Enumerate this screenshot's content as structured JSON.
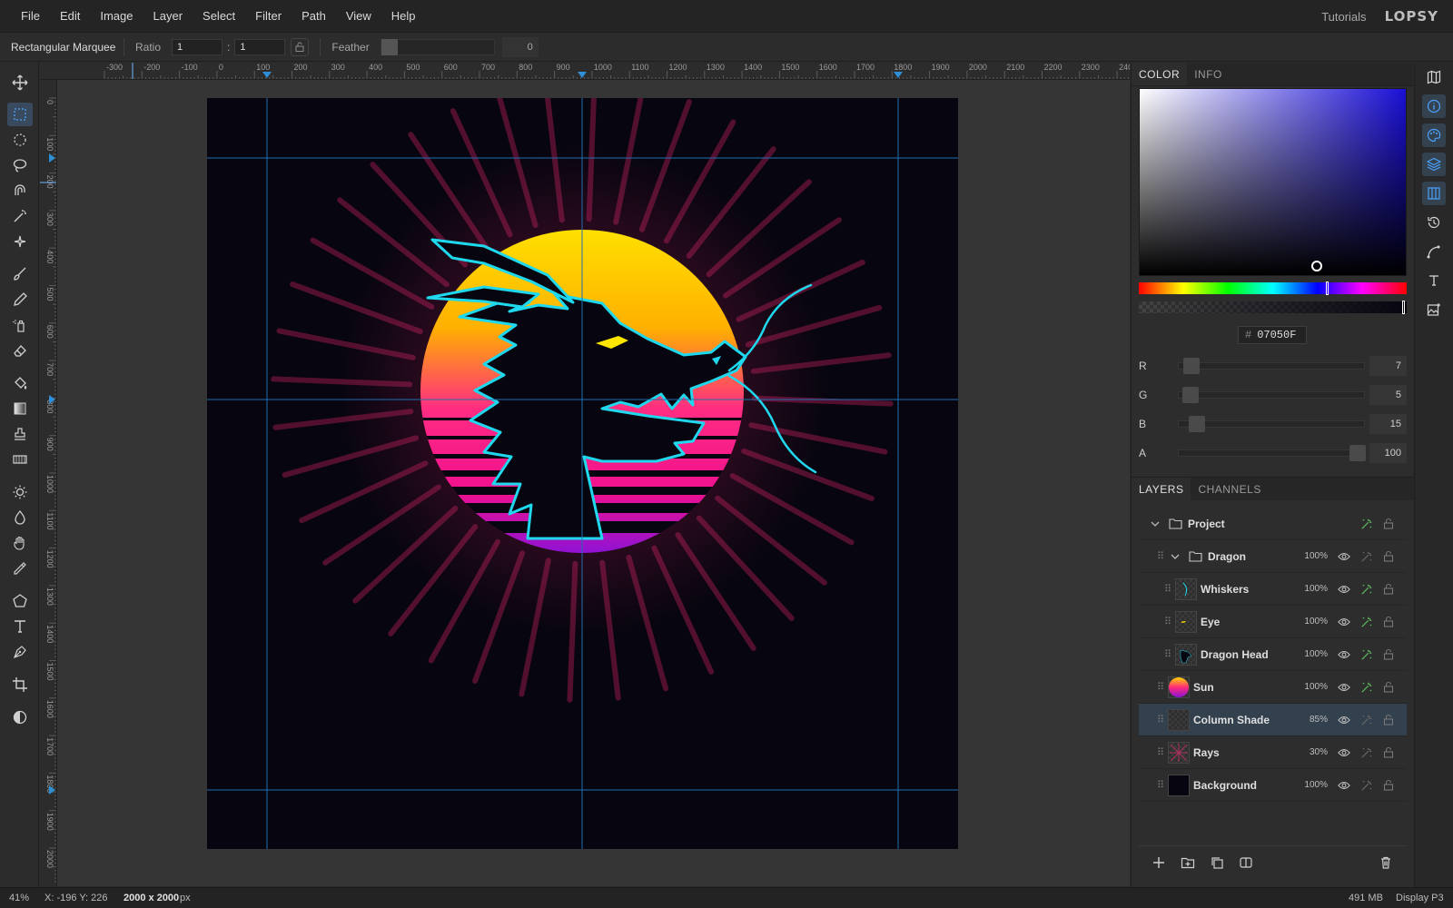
{
  "menu": {
    "items": [
      "File",
      "Edit",
      "Image",
      "Layer",
      "Select",
      "Filter",
      "Path",
      "View",
      "Help"
    ],
    "tutorials": "Tutorials",
    "logo": "LOPSY"
  },
  "options": {
    "tool_name": "Rectangular Marquee",
    "ratio_label": "Ratio",
    "ratio_w": "1",
    "ratio_colon": ":",
    "ratio_h": "1",
    "feather_label": "Feather",
    "feather_value": "0"
  },
  "rulers": {
    "top_labels": [
      "-300",
      "-200",
      "-100",
      "0",
      "100",
      "200",
      "300",
      "400",
      "500",
      "600",
      "700",
      "800",
      "900",
      "1000",
      "1100",
      "1200",
      "1300",
      "1400",
      "1500",
      "1600",
      "1700",
      "1800",
      "1900",
      "2000",
      "2100",
      "2200",
      "2300",
      "240"
    ],
    "left_labels": [
      "0",
      "100",
      "200",
      "300",
      "400",
      "500",
      "600",
      "700",
      "800",
      "900",
      "1000",
      "1100",
      "1200",
      "1300",
      "1400",
      "1500",
      "1600",
      "1700",
      "1800",
      "1900",
      "2000"
    ]
  },
  "color_panel": {
    "tabs": [
      "COLOR",
      "INFO"
    ],
    "hex_prefix": "#",
    "hex": "07050F",
    "hue_level": 0.7,
    "sat_level": 0.66,
    "brightness_level": 0.06,
    "channels": [
      {
        "label": "R",
        "value": "7",
        "level": 0.027
      },
      {
        "label": "G",
        "value": "5",
        "level": 0.02
      },
      {
        "label": "B",
        "value": "15",
        "level": 0.059
      },
      {
        "label": "A",
        "value": "100",
        "level": 1.0
      }
    ]
  },
  "layers_panel": {
    "tabs": [
      "LAYERS",
      "CHANNELS"
    ],
    "layers": [
      {
        "name": "Project",
        "opacity": "",
        "kind": "group",
        "depth": 0
      },
      {
        "name": "Dragon",
        "opacity": "100%",
        "kind": "group",
        "depth": 1
      },
      {
        "name": "Whiskers",
        "opacity": "100%",
        "kind": "layer",
        "depth": 2
      },
      {
        "name": "Eye",
        "opacity": "100%",
        "kind": "layer",
        "depth": 2
      },
      {
        "name": "Dragon Head",
        "opacity": "100%",
        "kind": "layer",
        "depth": 2
      },
      {
        "name": "Sun",
        "opacity": "100%",
        "kind": "layer",
        "depth": 1
      },
      {
        "name": "Column Shade",
        "opacity": "85%",
        "kind": "layer",
        "depth": 1,
        "selected": true
      },
      {
        "name": "Rays",
        "opacity": "30%",
        "kind": "layer",
        "depth": 1
      },
      {
        "name": "Background",
        "opacity": "100%",
        "kind": "layer",
        "depth": 1
      }
    ]
  },
  "status": {
    "zoom": "41%",
    "coords": "X: -196 Y: 226",
    "doc_size": "2000 x 2000",
    "doc_unit": "px",
    "memory": "491 MB",
    "profile": "Display P3"
  },
  "colors": {
    "accent": "#12a4ea",
    "guide": "#1f6fb0",
    "canvas_bg": "#07050f",
    "dragon_outline": "#1fd8ee",
    "eye": "#ffe600",
    "sun_top": "#ffd400",
    "sun_mid": "#ff2a7a",
    "sun_bottom": "#8a12d8"
  }
}
